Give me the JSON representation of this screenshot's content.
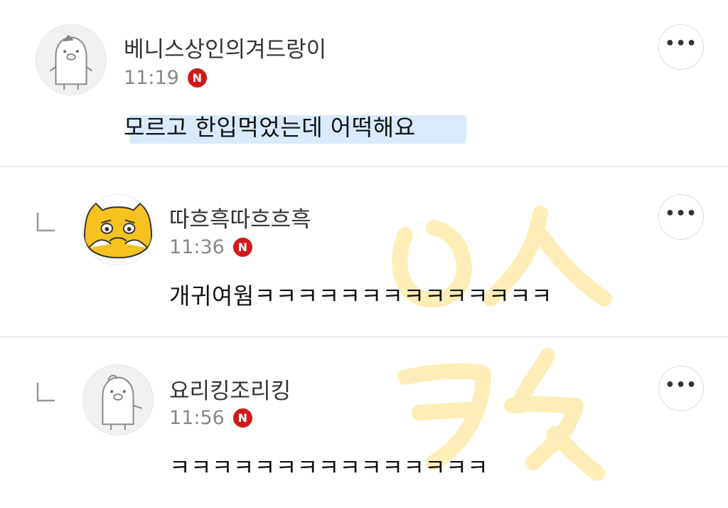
{
  "comments": [
    {
      "author": "베니스상인의겨드랑이",
      "time": "11:19",
      "badge": "N",
      "text": "모르고 한입먹었는데 어떡해요",
      "avatar": "pig-avatar-icon",
      "is_reply": false,
      "more_label": "•••"
    },
    {
      "author": "따흐흑따흐흐흑",
      "time": "11:36",
      "badge": "N",
      "text": "개귀여웜ㅋㅋㅋㅋㅋㅋㅋㅋㅋㅋㅋㅋㅋㅋ",
      "avatar": "crying-yellow-cat-avatar-icon",
      "is_reply": true,
      "more_label": "•••"
    },
    {
      "author": "요리킹조리킹",
      "time": "11:56",
      "badge": "N",
      "text": "ㅋㅋㅋㅋㅋㅋㅋㅋㅋㅋㅋㅋㅋㅋㅋ",
      "avatar": "pig-avatar-icon",
      "is_reply": true,
      "more_label": "•••"
    }
  ],
  "colors": {
    "badge": "#d01a1a",
    "highlight": "#d9eafc",
    "watermark": "#fde9a0",
    "divider": "#dedede"
  }
}
